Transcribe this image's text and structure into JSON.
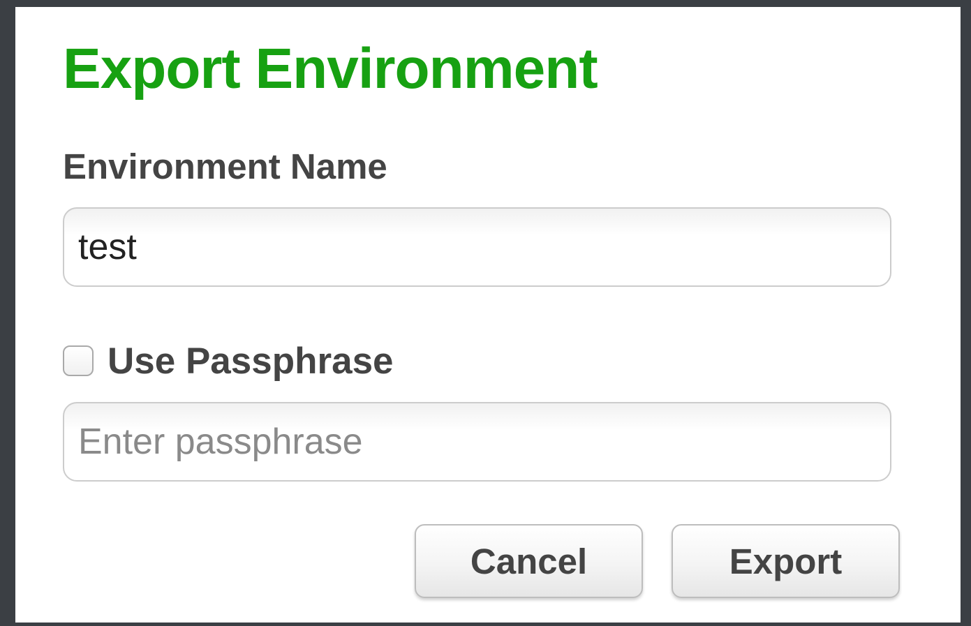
{
  "dialog": {
    "title": "Export Environment",
    "environment_name": {
      "label": "Environment Name",
      "value": "test"
    },
    "passphrase": {
      "checkbox_label": "Use Passphrase",
      "checked": false,
      "placeholder": "Enter passphrase",
      "value": ""
    },
    "buttons": {
      "cancel": "Cancel",
      "export": "Export"
    }
  },
  "colors": {
    "title": "#17a112",
    "label": "#444444",
    "background": "#3b3f44",
    "dialog": "#ffffff"
  }
}
